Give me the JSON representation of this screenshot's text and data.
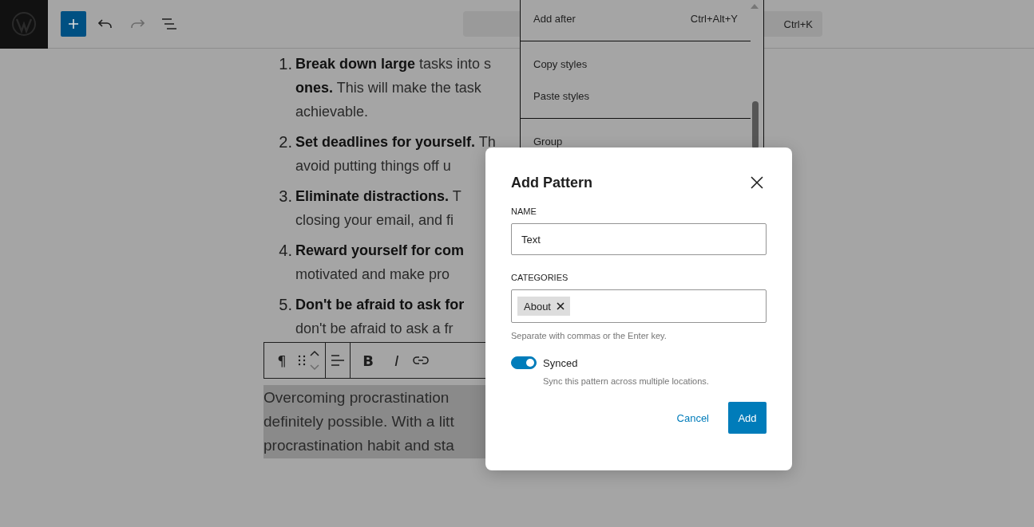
{
  "top_bar": {
    "tools": [
      {
        "kind": "inserter",
        "disabled": false
      },
      {
        "kind": "undo",
        "disabled": false
      },
      {
        "kind": "redo",
        "disabled": true
      },
      {
        "kind": "list-view",
        "disabled": false
      }
    ],
    "command_shortcut": "Ctrl+K"
  },
  "menu": {
    "items": [
      {
        "kind": "item",
        "label": "Add after",
        "shortcut": "Ctrl+Alt+Y"
      },
      {
        "kind": "divider"
      },
      {
        "kind": "item",
        "label": "Copy styles"
      },
      {
        "kind": "item",
        "label": "Paste styles"
      },
      {
        "kind": "divider"
      },
      {
        "kind": "item",
        "label": "Group"
      }
    ]
  },
  "list": [
    {
      "number": "1.",
      "lines": [
        "**Break down large** tasks into s",
        "**ones.** This will make the task",
        "achievable."
      ]
    },
    {
      "number": "2.",
      "lines": [
        "**Set deadlines for yourself.** Th",
        "avoid putting things off u"
      ]
    },
    {
      "number": "3.",
      "lines": [
        "**Eliminate distractions.** T",
        "closing your email, and fi"
      ]
    },
    {
      "number": "4.",
      "lines": [
        "**Reward yourself for com**",
        "motivated and make pro"
      ]
    },
    {
      "number": "5.",
      "lines": [
        "**Don't be afraid to ask for**",
        "don't be afraid to ask a fr"
      ]
    }
  ],
  "block_toolbar": {
    "groups": [
      [
        {
          "kind": "text",
          "text": "¶"
        },
        {
          "kind": "drag"
        },
        {
          "kind": "move"
        }
      ],
      [
        {
          "kind": "align"
        }
      ],
      [
        {
          "kind": "bold",
          "text": "B"
        },
        {
          "kind": "italic",
          "text": "I"
        },
        {
          "kind": "link"
        }
      ]
    ]
  },
  "paragraph": {
    "selected": true,
    "lines": [
      "Overcoming procrastination",
      "definitely possible. With a litt",
      "procrastination habit and sta"
    ]
  },
  "modal": {
    "title": "Add Pattern",
    "name_label": "NAME",
    "name_value": "Text",
    "categories_label": "CATEGORIES",
    "categories": [
      "About"
    ],
    "categories_help": "Separate with commas or the Enter key.",
    "synced": {
      "label": "Synced",
      "on": true,
      "help": "Sync this pattern across multiple locations."
    },
    "cancel": "Cancel",
    "submit": "Add"
  }
}
